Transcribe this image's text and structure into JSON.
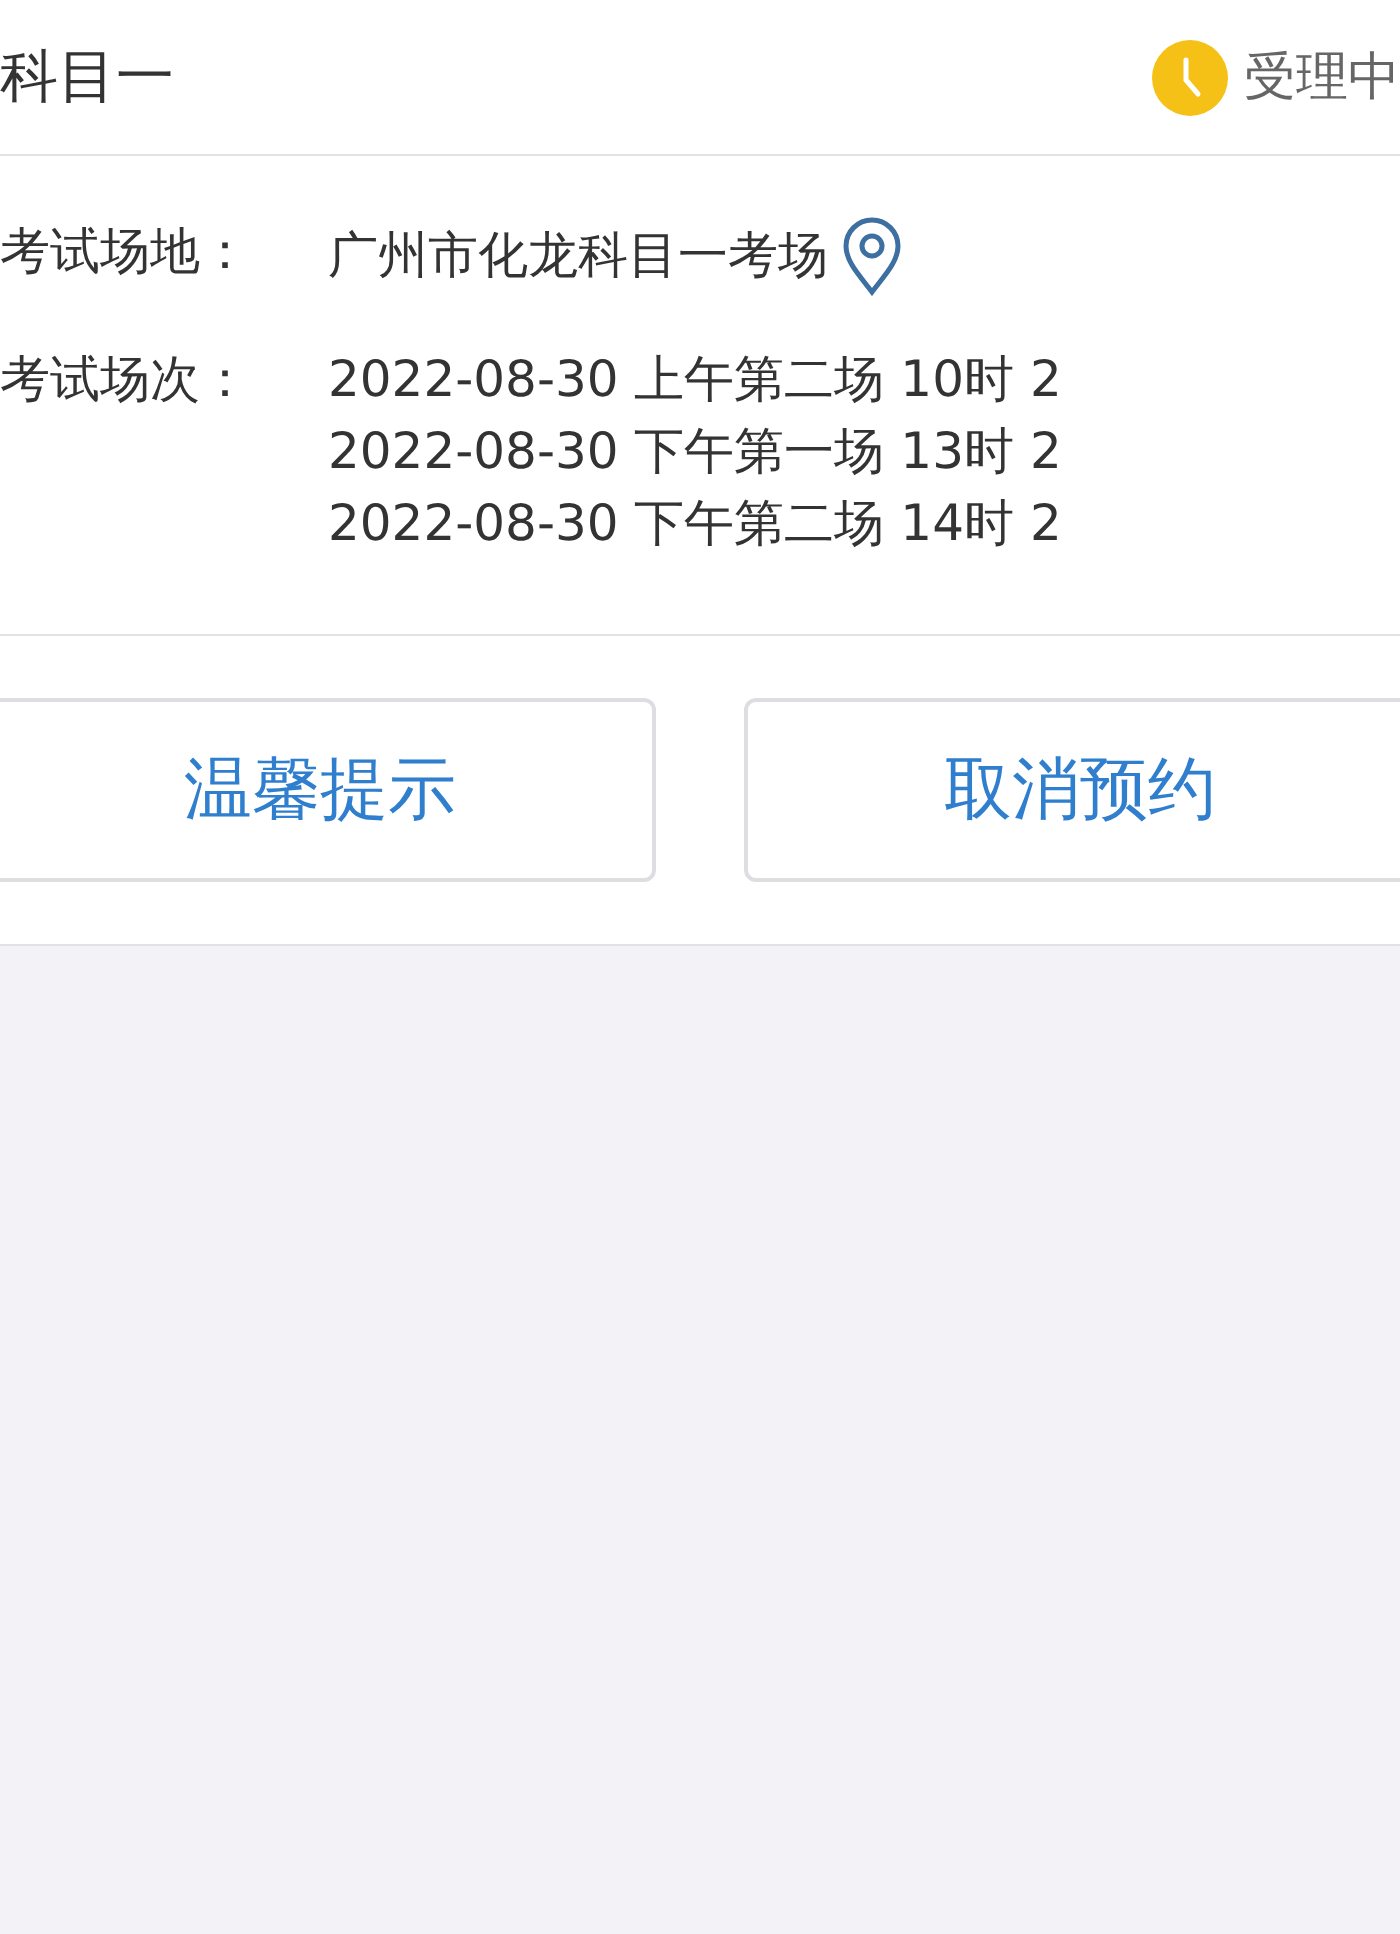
{
  "header": {
    "title": "科目一",
    "status": "受理中"
  },
  "fields": [
    {
      "kind": "location",
      "label": "考试场地：",
      "values": [
        "广州市化龙科目一考场"
      ]
    },
    {
      "kind": "list",
      "label": "考试场次：",
      "values": [
        "2022-08-30 上午第二场 10时 2",
        "2022-08-30 下午第一场 13时 2",
        "2022-08-30 下午第二场 14时 2"
      ]
    }
  ],
  "buttons": [
    "温馨提示",
    "取消预约"
  ]
}
